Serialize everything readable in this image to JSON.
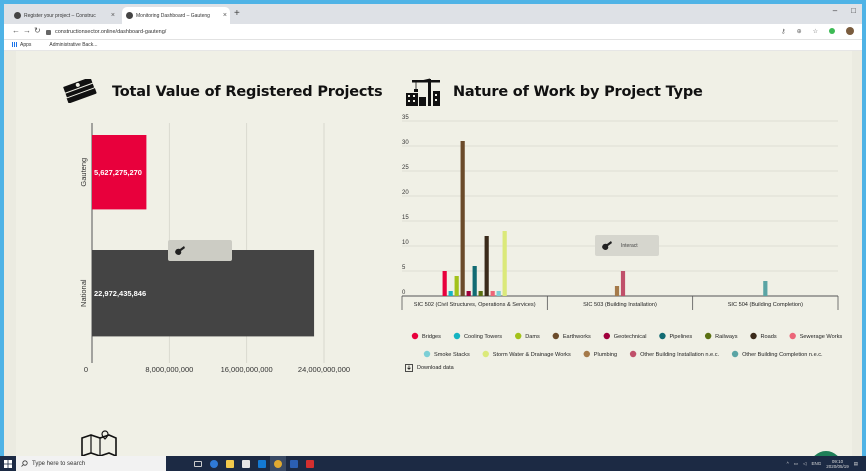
{
  "browser": {
    "tabs": [
      {
        "title": "Register your project – Construc"
      },
      {
        "title": "Monitoring Dashboard – Gauteng"
      }
    ],
    "url": "constructionsector.online/dashboard-gauteng/",
    "bookmarks": [
      {
        "label": "Apps"
      },
      {
        "label": "Administrative Back..."
      }
    ]
  },
  "page": {
    "left_title": "Total Value of Registered Projects",
    "right_title": "Nature of Work by Project Type"
  },
  "value_chart": {
    "tooltip": {
      "label": "Interact"
    }
  },
  "nature_chart": {
    "tooltip": {
      "label": "Interact"
    },
    "download_label": "Download data"
  },
  "chart_data": [
    {
      "type": "bar",
      "orientation": "horizontal",
      "title": "Total Value of Registered Projects",
      "categories": [
        "Gauteng",
        "National"
      ],
      "values": [
        5627275270,
        22972435846
      ],
      "value_labels": [
        "5,627,275,270",
        "22,972,435,846"
      ],
      "colors": [
        "#e8003c",
        "#444444"
      ],
      "xlim": [
        0,
        24000000000
      ],
      "ticks": [
        0,
        8000000000,
        16000000000,
        24000000000
      ],
      "tick_labels": [
        "0",
        "8,000,000,000",
        "16,000,000,000",
        "24,000,000,000"
      ],
      "grid": true
    },
    {
      "type": "bar",
      "title": "Nature of Work by Project Type",
      "categories": [
        "SIC 502 (Civil Structures, Operations & Services)",
        "SIC 503 (Building Installation)",
        "SIC 504 (Building Completion)"
      ],
      "ylim": [
        0,
        35
      ],
      "yticks": [
        0,
        5,
        10,
        15,
        20,
        25,
        30,
        35
      ],
      "grid": true,
      "legend": "bottom",
      "series": [
        {
          "name": "Bridges",
          "color": "#e8003c",
          "values": [
            5,
            0,
            0
          ]
        },
        {
          "name": "Cooling Towers",
          "color": "#16b4c1",
          "values": [
            1,
            0,
            0
          ]
        },
        {
          "name": "Dams",
          "color": "#a3c21a",
          "values": [
            4,
            0,
            0
          ]
        },
        {
          "name": "Earthworks",
          "color": "#6b4b2a",
          "values": [
            31,
            0,
            0
          ]
        },
        {
          "name": "Geotechnical",
          "color": "#a0003c",
          "values": [
            1,
            0,
            0
          ]
        },
        {
          "name": "Pipelines",
          "color": "#126b73",
          "values": [
            6,
            0,
            0
          ]
        },
        {
          "name": "Railways",
          "color": "#5a7012",
          "values": [
            1,
            0,
            0
          ]
        },
        {
          "name": "Roads",
          "color": "#3a2a1a",
          "values": [
            12,
            0,
            0
          ]
        },
        {
          "name": "Sewerage Works",
          "color": "#ec6679",
          "values": [
            1,
            0,
            0
          ]
        },
        {
          "name": "Smoke Stacks",
          "color": "#7ccfd6",
          "values": [
            1,
            0,
            0
          ]
        },
        {
          "name": "Storm Water & Drainage Works",
          "color": "#dbe97a",
          "values": [
            13,
            0,
            0
          ]
        },
        {
          "name": "Plumbing",
          "color": "#a57a4a",
          "values": [
            0,
            2,
            0
          ]
        },
        {
          "name": "Other Building Installation n.e.c.",
          "color": "#c0506a",
          "values": [
            0,
            5,
            0
          ]
        },
        {
          "name": "Other Building Completion n.e.c.",
          "color": "#5aa4a4",
          "values": [
            0,
            0,
            3
          ]
        }
      ]
    }
  ],
  "taskbar": {
    "search_placeholder": "Type here to search",
    "language": "ENG",
    "time": "09:10",
    "date": "2020/05/19"
  }
}
